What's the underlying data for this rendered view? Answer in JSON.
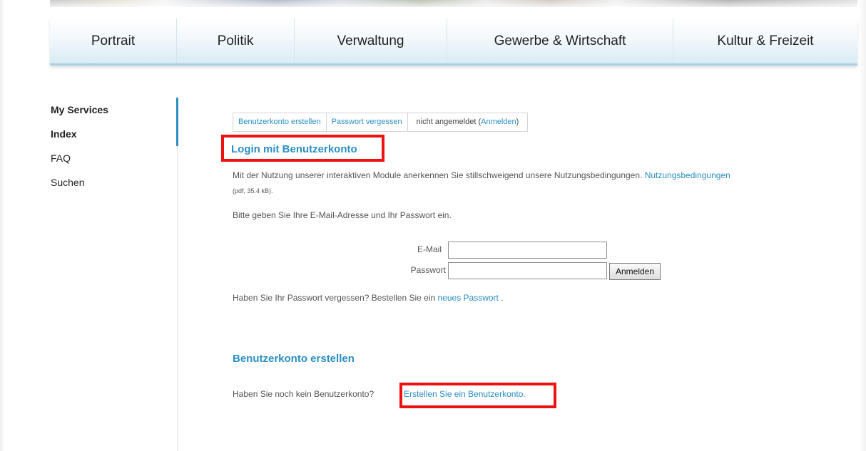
{
  "nav": {
    "items": [
      "Portrait",
      "Politik",
      "Verwaltung",
      "Gewerbe & Wirtschaft",
      "Kultur & Freizeit"
    ]
  },
  "sidebar": {
    "items": [
      "My Services",
      "Index",
      "FAQ",
      "Suchen"
    ]
  },
  "tabs": {
    "create_account": "Benutzerkonto erstellen",
    "forgot_password": "Passwort vergessen",
    "status_prefix": "nicht angemeldet (",
    "status_link": "Anmelden",
    "status_suffix": ")"
  },
  "login": {
    "heading": "Login mit Benutzerkonto",
    "terms_text": "Mit der Nutzung unserer interaktiven Module anerkennen Sie stillschweigend unsere Nutzungsbedingungen. ",
    "terms_link": "Nutzungsbedingungen",
    "terms_meta": "(pdf, 35.4 kB).",
    "instruction": "Bitte geben Sie Ihre E-Mail-Adresse und Ihr Passwort ein.",
    "email_label": "E-Mail",
    "password_label": "Passwort",
    "email_value": "",
    "password_value": "",
    "submit_label": "Anmelden",
    "forgot_text": "Haben Sie Ihr Passwort vergessen? Bestellen Sie ein ",
    "forgot_link": "neues Passwort",
    "forgot_suffix": " ."
  },
  "create": {
    "heading": "Benutzerkonto erstellen",
    "text": "Haben Sie noch kein Benutzerkonto? ",
    "link": "Erstellen Sie ein Benutzerkonto."
  },
  "colors": {
    "accent": "#2a8fc4",
    "highlight": "#ee1111"
  }
}
